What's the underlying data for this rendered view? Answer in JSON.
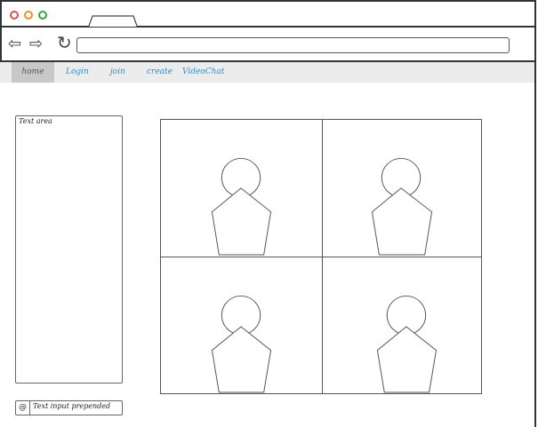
{
  "menu": {
    "items": [
      {
        "label": "home",
        "active": true
      },
      {
        "label": "Login",
        "active": false
      },
      {
        "label": "join",
        "active": false
      },
      {
        "label": "create",
        "active": false
      },
      {
        "label": "VideoChat",
        "active": false
      }
    ]
  },
  "text_area": {
    "label": "Text area"
  },
  "text_input": {
    "icon": "at-sign-icon",
    "placeholder": "Text input prepended"
  },
  "video_grid": {
    "tiles": [
      "participant-1",
      "participant-2",
      "participant-3",
      "participant-4"
    ]
  },
  "colors": {
    "menu_link": "#2b8fd6",
    "menu_active_bg": "#c8c8c8",
    "menu_bar_bg": "#ececec"
  }
}
